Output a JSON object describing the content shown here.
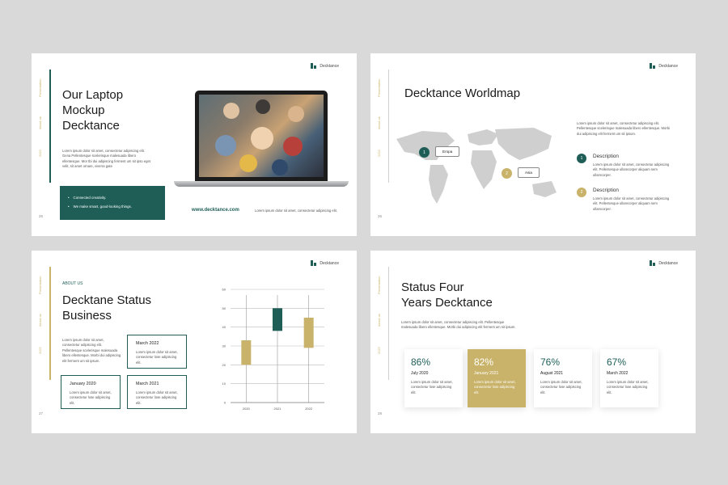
{
  "brand": "Decktance",
  "side_words": [
    "Presentation",
    "About us",
    "2022"
  ],
  "slides": [
    {
      "page": "25",
      "title_lines": [
        "Our Laptop",
        "Mockup",
        "Decktance"
      ],
      "body": "Lorem ipsum dolor sit amet, consectetur adipiscing elit. Gena Pellentesque scelerisque malesuada libero ellentesque. Mor tbi dui adipiscing ferment um sit ipso eget velit, sit amet ornare, viverra gate",
      "bullets": [
        "Connected creativity.",
        "We make smart, good-looking things."
      ],
      "url": "www.decktance.com",
      "url_caption": "Lorem ipsum dolor sit amet, consectetur adipiscing elit."
    },
    {
      "page": "26",
      "title": "Decktance Worldmap",
      "intro": "Lorem ipsum dolor sit amet, consectetur adipiscing elit. Pellentesque scelerisque malesuada libero ellentesque. Morbi dui adipiscing elit ferment um sit ipsum.",
      "pins": [
        {
          "num": "1",
          "label": "Eropa",
          "color": "#1e5e57"
        },
        {
          "num": "2",
          "label": "Asia",
          "color": "#c9b36a"
        }
      ],
      "descriptions": [
        {
          "num": "1",
          "title": "Description",
          "text": "Lorem ipsum dolor sit amet, consectetur adipiscing elit. Pellentesque ullamcorper aliquam sem ullamcorper.",
          "color": "#1e5e57"
        },
        {
          "num": "2",
          "title": "Description",
          "text": "Lorem ipsum dolor sit amet, consectetur adipiscing elit. Pellentesque ullamcorper aliquam sem ullamcorper.",
          "color": "#c9b36a"
        }
      ]
    },
    {
      "page": "27",
      "label": "ABOUT US",
      "title_lines": [
        "Decktane Status",
        "Business"
      ],
      "body": "Lorem ipsum dolor sit amet, consectetur adipiscing elit. Pellentesque scelerisque malesuada libero ellentesque. Morbi dui adipiscing elit ferment um sit ipsum.",
      "boxes": [
        {
          "head": "March 2022",
          "text": "Lorem ipsum dolor sit amet, consectetur lose adipiscing elit."
        },
        {
          "head": "January 2020",
          "text": "Lorem ipsum dolor sit amet, consectetur lose adipiscing elit."
        },
        {
          "head": "March 2021",
          "text": "Lorem ipsum dolor sit amet, consectetur lose adipiscing elit."
        }
      ]
    },
    {
      "page": "28",
      "title_lines": [
        "Status Four",
        "Years Decktance"
      ],
      "body": "Lorem ipsum dolor sit amet, consectetur adipiscing elit. Pellentesque malesuada libero ellentesque. Morbi dui adipiscing elit ferment um sit ipsum.",
      "cards": [
        {
          "pct": "86%",
          "date": "July 2020",
          "text": "Lorem ipsum dolor sit amet, consectetur lose adipiscing elit.",
          "highlight": false
        },
        {
          "pct": "82%",
          "date": "January 2021",
          "text": "Lorem ipsum dolor sit amet, consectetur lose adipiscing elit.",
          "highlight": true
        },
        {
          "pct": "76%",
          "date": "August 2021",
          "text": "Lorem ipsum dolor sit amet, consectetur lose adipiscing elit.",
          "highlight": false
        },
        {
          "pct": "67%",
          "date": "March 2022",
          "text": "Lorem ipsum dolor sit amet, consectetur lose adipiscing elit.",
          "highlight": false
        }
      ]
    }
  ],
  "colors": {
    "teal": "#1e5e57",
    "gold": "#c9b36a",
    "background": "#d9d9d9"
  },
  "chart_data": {
    "type": "bar",
    "categories": [
      "2020",
      "2021",
      "2022"
    ],
    "series": [
      {
        "values": [
          [
            20,
            33
          ],
          [
            38,
            50
          ],
          [
            29,
            45
          ]
        ]
      }
    ],
    "series_colors": [
      "#c9b36a",
      "#1e5e57",
      "#c9b36a"
    ],
    "yticks": [
      "0",
      "10",
      "20",
      "30",
      "40",
      "50",
      "60"
    ],
    "ylim": [
      0,
      60
    ],
    "grid": true,
    "title": "",
    "xlabel": "",
    "ylabel": ""
  }
}
